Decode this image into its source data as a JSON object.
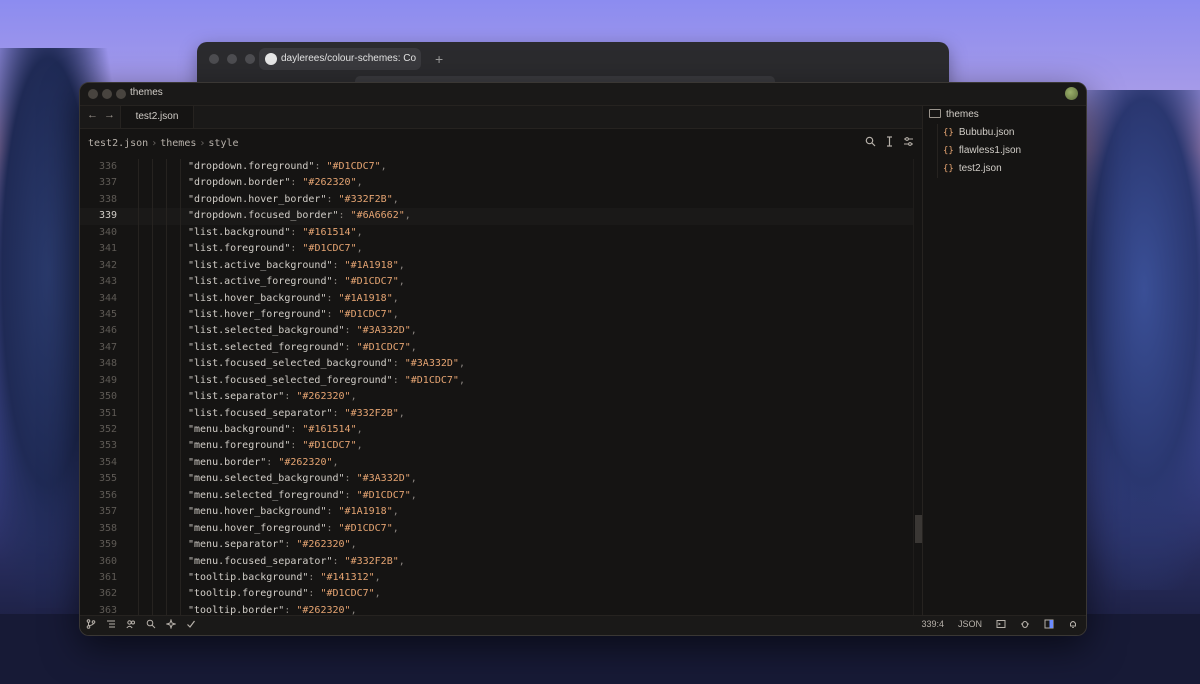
{
  "browser": {
    "tab_title": "daylerees/colour-schemes: Co",
    "new_tab_icon": "+"
  },
  "editor": {
    "window_title": "themes",
    "nav": {
      "back": "←",
      "forward": "→"
    },
    "active_tab": "test2.json",
    "breadcrumb": [
      "test2.json",
      "themes",
      "style"
    ],
    "active_line": 339,
    "lines": [
      {
        "n": "336",
        "key": "\"dropdown.foreground\"",
        "val": "\"#D1CDC7\""
      },
      {
        "n": "337",
        "key": "\"dropdown.border\"",
        "val": "\"#262320\""
      },
      {
        "n": "338",
        "key": "\"dropdown.hover_border\"",
        "val": "\"#332F2B\""
      },
      {
        "n": "339",
        "key": "\"dropdown.focused_border\"",
        "val": "\"#6A6662\""
      },
      {
        "n": "340",
        "key": "\"list.background\"",
        "val": "\"#161514\""
      },
      {
        "n": "341",
        "key": "\"list.foreground\"",
        "val": "\"#D1CDC7\""
      },
      {
        "n": "342",
        "key": "\"list.active_background\"",
        "val": "\"#1A1918\""
      },
      {
        "n": "343",
        "key": "\"list.active_foreground\"",
        "val": "\"#D1CDC7\""
      },
      {
        "n": "344",
        "key": "\"list.hover_background\"",
        "val": "\"#1A1918\""
      },
      {
        "n": "345",
        "key": "\"list.hover_foreground\"",
        "val": "\"#D1CDC7\""
      },
      {
        "n": "346",
        "key": "\"list.selected_background\"",
        "val": "\"#3A332D\""
      },
      {
        "n": "347",
        "key": "\"list.selected_foreground\"",
        "val": "\"#D1CDC7\""
      },
      {
        "n": "348",
        "key": "\"list.focused_selected_background\"",
        "val": "\"#3A332D\""
      },
      {
        "n": "349",
        "key": "\"list.focused_selected_foreground\"",
        "val": "\"#D1CDC7\""
      },
      {
        "n": "350",
        "key": "\"list.separator\"",
        "val": "\"#262320\""
      },
      {
        "n": "351",
        "key": "\"list.focused_separator\"",
        "val": "\"#332F2B\""
      },
      {
        "n": "352",
        "key": "\"menu.background\"",
        "val": "\"#161514\""
      },
      {
        "n": "353",
        "key": "\"menu.foreground\"",
        "val": "\"#D1CDC7\""
      },
      {
        "n": "354",
        "key": "\"menu.border\"",
        "val": "\"#262320\""
      },
      {
        "n": "355",
        "key": "\"menu.selected_background\"",
        "val": "\"#3A332D\""
      },
      {
        "n": "356",
        "key": "\"menu.selected_foreground\"",
        "val": "\"#D1CDC7\""
      },
      {
        "n": "357",
        "key": "\"menu.hover_background\"",
        "val": "\"#1A1918\""
      },
      {
        "n": "358",
        "key": "\"menu.hover_foreground\"",
        "val": "\"#D1CDC7\""
      },
      {
        "n": "359",
        "key": "\"menu.separator\"",
        "val": "\"#262320\""
      },
      {
        "n": "360",
        "key": "\"menu.focused_separator\"",
        "val": "\"#332F2B\""
      },
      {
        "n": "361",
        "key": "\"tooltip.background\"",
        "val": "\"#141312\""
      },
      {
        "n": "362",
        "key": "\"tooltip.foreground\"",
        "val": "\"#D1CDC7\""
      },
      {
        "n": "363",
        "key": "\"tooltip.border\"",
        "val": "\"#262320\""
      }
    ]
  },
  "sidebar": {
    "folder": "themes",
    "files": [
      "Bububu.json",
      "flawless1.json",
      "test2.json"
    ],
    "json_icon": "{}"
  },
  "statusbar": {
    "cursor": "339:4",
    "language": "JSON"
  },
  "colors": {
    "bg": "#151413",
    "fg": "#D1CDC7",
    "string": "#E5A472",
    "border": "#262320"
  }
}
